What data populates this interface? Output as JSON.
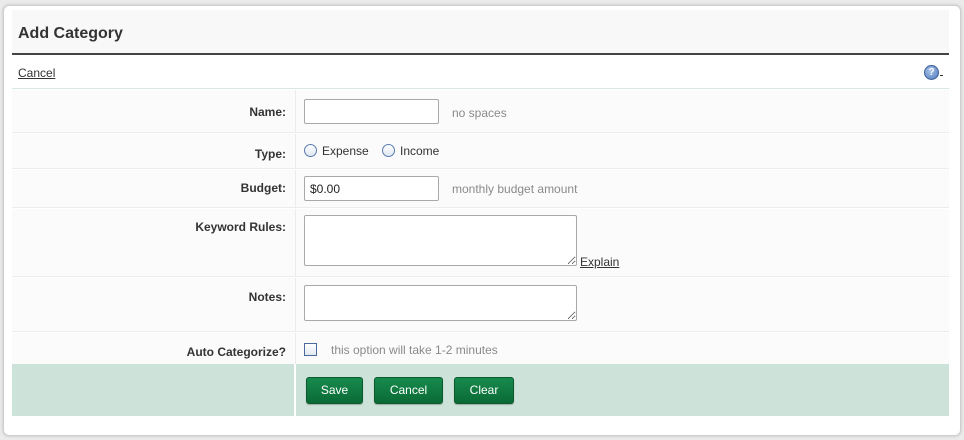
{
  "header": {
    "title": "Add Category"
  },
  "actions": {
    "cancel_link": "Cancel",
    "help_icon": "?"
  },
  "form": {
    "name": {
      "label": "Name:",
      "value": "",
      "hint": "no spaces"
    },
    "type": {
      "label": "Type:",
      "options": [
        "Expense",
        "Income"
      ]
    },
    "budget": {
      "label": "Budget:",
      "value": "$0.00",
      "hint": "monthly budget amount"
    },
    "keyword_rules": {
      "label": "Keyword Rules:",
      "value": "",
      "explain_link": "Explain"
    },
    "notes": {
      "label": "Notes:",
      "value": ""
    },
    "auto_categorize": {
      "label": "Auto Categorize?",
      "hint": "this option will take 1-2 minutes"
    }
  },
  "buttons": {
    "save": "Save",
    "cancel": "Cancel",
    "clear": "Clear"
  },
  "colors": {
    "button_green": "#0a6a35",
    "button_bar_bg": "#cde3d9",
    "title_rule": "#444444"
  }
}
